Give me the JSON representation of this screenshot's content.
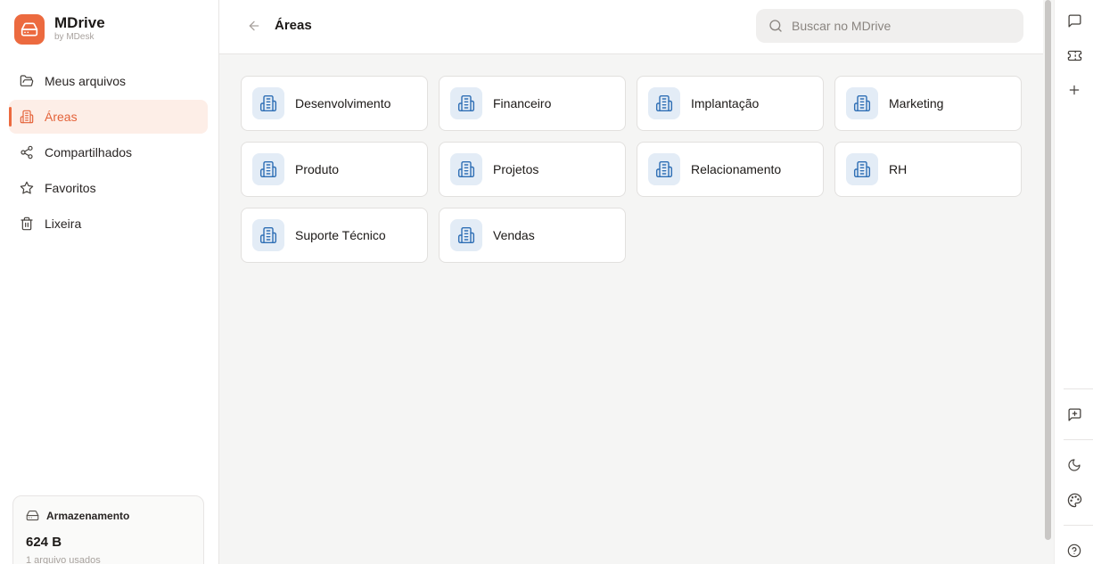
{
  "brand": {
    "name": "MDrive",
    "sub": "by MDesk",
    "color": "#ec6a3f"
  },
  "nav": [
    {
      "label": "Meus arquivos",
      "icon": "folder-open-icon"
    },
    {
      "label": "Áreas",
      "icon": "building-icon",
      "active": true
    },
    {
      "label": "Compartilhados",
      "icon": "share-icon"
    },
    {
      "label": "Favoritos",
      "icon": "star-icon"
    },
    {
      "label": "Lixeira",
      "icon": "trash-icon"
    }
  ],
  "storage": {
    "title": "Armazenamento",
    "value": "624 B",
    "sub": "1 arquivo usados"
  },
  "header": {
    "title": "Áreas",
    "search_placeholder": "Buscar no MDrive"
  },
  "areas": [
    {
      "label": "Desenvolvimento",
      "icon": "building-icon"
    },
    {
      "label": "Financeiro",
      "icon": "building-icon"
    },
    {
      "label": "Implantação",
      "icon": "building-icon"
    },
    {
      "label": "Marketing",
      "icon": "building-icon"
    },
    {
      "label": "Produto",
      "icon": "building-icon"
    },
    {
      "label": "Projetos",
      "icon": "building-icon"
    },
    {
      "label": "Relacionamento",
      "icon": "building-icon"
    },
    {
      "label": "RH",
      "icon": "building-icon"
    },
    {
      "label": "Suporte Técnico",
      "icon": "building-icon"
    },
    {
      "label": "Vendas",
      "icon": "building-icon"
    }
  ],
  "rail": [
    "chat-icon",
    "ticket-icon",
    "plus-icon",
    "add-message-icon",
    "moon-icon",
    "palette-icon",
    "help-icon"
  ],
  "colors": {
    "accent": "#ec6a3f",
    "accent_bg": "#fdeee7",
    "card_icon_bg": "#e3ecf6",
    "card_icon": "#2f6fb5"
  }
}
